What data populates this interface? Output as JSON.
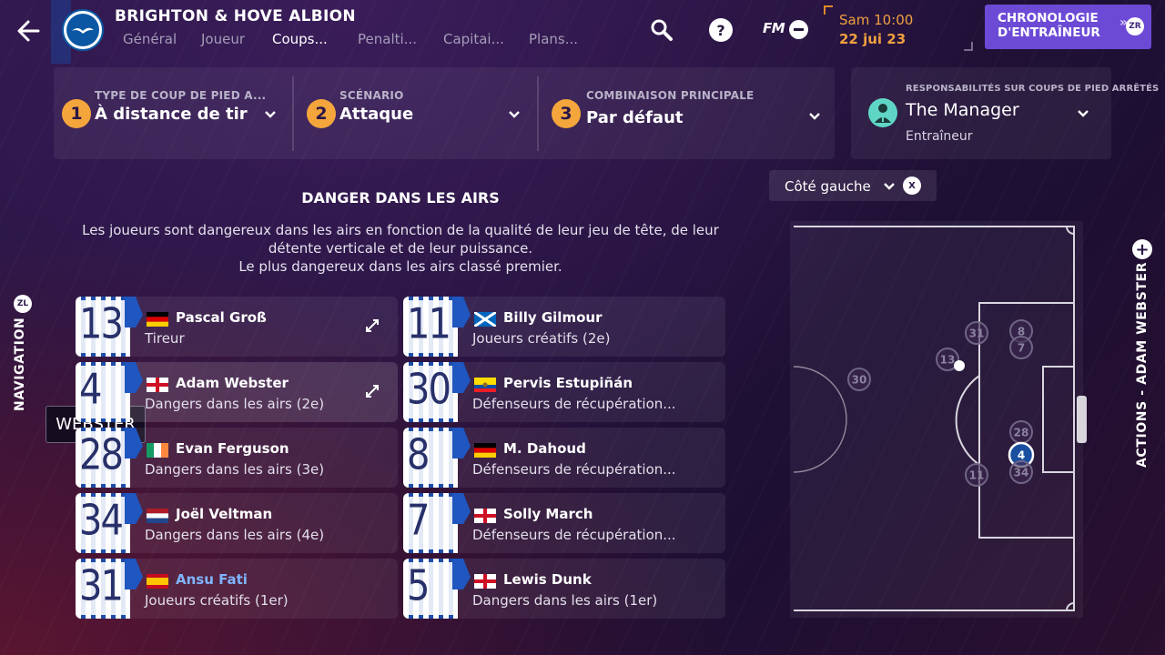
{
  "header": {
    "club_name": "BRIGHTON & HOVE ALBION",
    "tabs": [
      {
        "label": "Général",
        "active": false
      },
      {
        "label": "Joueur",
        "active": false
      },
      {
        "label": "Coups...",
        "active": true
      },
      {
        "label": "Penalti...",
        "active": false
      },
      {
        "label": "Capitai...",
        "active": false
      },
      {
        "label": "Plans...",
        "active": false
      }
    ],
    "help_label": "?",
    "fm_label": "FM",
    "time": "Sam 10:00",
    "date": "22 jui 23",
    "chrono_line1": "CHRONOLOGIE",
    "chrono_line2": "D'ENTRAÎNEUR",
    "chrono_badge": "ZR"
  },
  "selectors": [
    {
      "step": "1",
      "label": "TYPE DE COUP DE PIED A...",
      "value": "À distance de tir"
    },
    {
      "step": "2",
      "label": "SCÉNARIO",
      "value": "Attaque"
    },
    {
      "step": "3",
      "label": "COMBINAISON PRINCIPALE",
      "value": "Par défaut"
    }
  ],
  "responsibility": {
    "label": "RESPONSABILITÉS SUR COUPS DE PIED ARRÊTÉS",
    "name": "The Manager",
    "role": "Entraîneur"
  },
  "section": {
    "title": "DANGER DANS LES AIRS",
    "desc_line1": "Les joueurs sont dangereux dans les airs en fonction de la qualité de leur jeu de tête, de leur",
    "desc_line2": "détente verticale et de leur puissance.",
    "desc_line3": "Le plus dangereux dans les airs classé premier."
  },
  "players_left": [
    {
      "number": "13",
      "flag": "germany",
      "name": "Pascal Groß",
      "role": "Tireur",
      "highlight": false
    },
    {
      "number": "4",
      "flag": "england",
      "name": "Adam Webster",
      "role": "Dangers dans les airs (2e)",
      "highlight": false
    },
    {
      "number": "28",
      "flag": "ireland",
      "name": "Evan Ferguson",
      "role": "Dangers dans les airs (3e)",
      "highlight": false
    },
    {
      "number": "34",
      "flag": "netherlands",
      "name": "Joël Veltman",
      "role": "Dangers dans les airs (4e)",
      "highlight": false
    },
    {
      "number": "31",
      "flag": "spain",
      "name": "Ansu Fati",
      "role": "Joueurs créatifs (1er)",
      "highlight": true
    }
  ],
  "players_right": [
    {
      "number": "11",
      "flag": "scotland",
      "name": "Billy Gilmour",
      "role": "Joueurs créatifs (2e)"
    },
    {
      "number": "30",
      "flag": "ecuador",
      "name": "Pervis Estupiñán",
      "role": "Défenseurs de récupération..."
    },
    {
      "number": "8",
      "flag": "germany",
      "name": "M. Dahoud",
      "role": "Défenseurs de récupération..."
    },
    {
      "number": "7",
      "flag": "england",
      "name": "Solly March",
      "role": "Défenseurs de récupération..."
    },
    {
      "number": "5",
      "flag": "england",
      "name": "Lewis Dunk",
      "role": "Dangers dans les airs (1er)"
    }
  ],
  "tooltip": "WEBSTER",
  "nav_label": "NAVIGATION",
  "nav_badge": "ZL",
  "actions_label": "ACTIONS - ADAM WEBSTER",
  "side_select": {
    "value": "Côté gauche",
    "clear_badge": "X"
  },
  "pitch_markers": [
    "31",
    "8",
    "7",
    "13",
    "30",
    "28",
    "4",
    "34",
    "11"
  ],
  "colors": {
    "accent": "#6d4ad6",
    "step": "#f4a53c",
    "date": "#f0a040",
    "selected_marker": "#1a4fa0"
  }
}
